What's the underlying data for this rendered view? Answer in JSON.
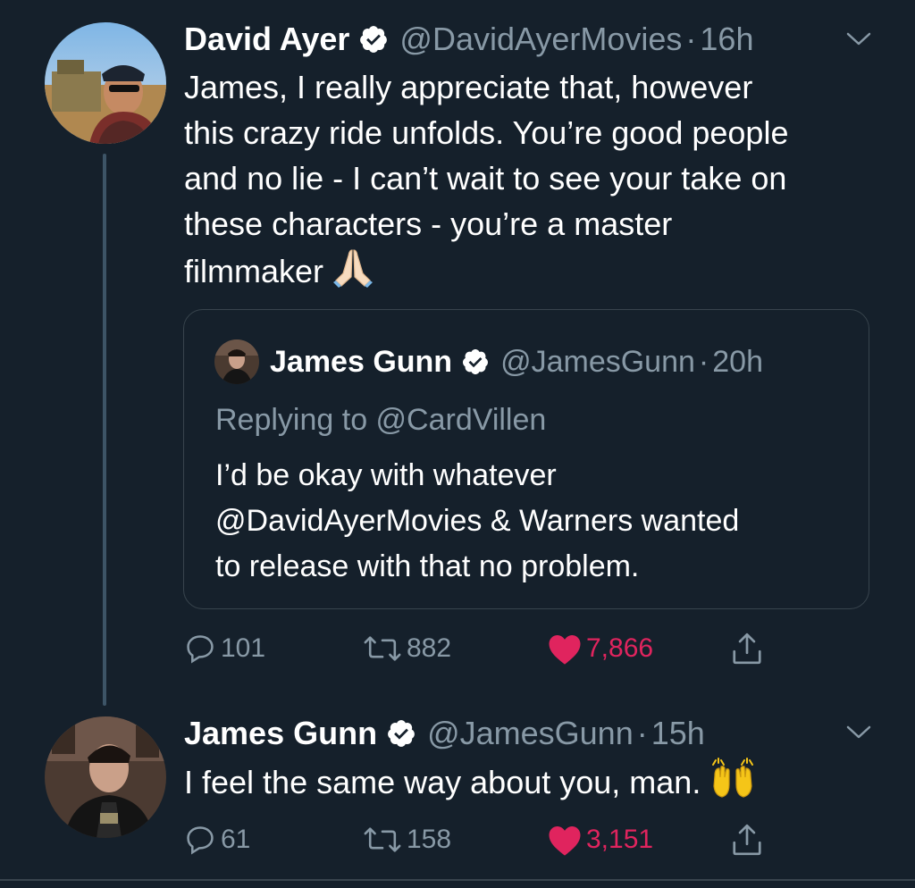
{
  "tweets": [
    {
      "name": "David Ayer",
      "handle": "@DavidAyerMovies",
      "dot": "·",
      "time": "16h",
      "text": "James, I really appreciate that, however\nthis crazy ride unfolds. You’re good people\nand no lie - I can’t wait to see your take on\nthese characters - you’re a master\nfilmmaker",
      "emoji": "folded-hands-emoji",
      "quote": {
        "name": "James Gunn",
        "handle": "@JamesGunn",
        "dot": "·",
        "time": "20h",
        "replying_to": "Replying to @CardVillen",
        "text": "I’d be okay with whatever\n@DavidAyerMovies & Warners wanted\nto release with that no problem."
      },
      "replies": "101",
      "retweets": "882",
      "likes": "7,866"
    },
    {
      "name": "James Gunn",
      "handle": "@JamesGunn",
      "dot": "·",
      "time": "15h",
      "text": "I feel the same way about you, man.",
      "emoji": "raising-hands-emoji",
      "replies": "61",
      "retweets": "158",
      "likes": "3,151"
    }
  ],
  "icons": {
    "reply": "reply-icon",
    "retweet": "retweet-icon",
    "like": "heart-icon",
    "share": "share-icon",
    "verified": "verified-badge-icon",
    "menu": "chevron-down-icon"
  },
  "colors": {
    "background": "#15202b",
    "secondary_text": "#8899a6",
    "verified": "#ffffff",
    "like": "#e0245e",
    "thread_line": "#3d5466"
  }
}
